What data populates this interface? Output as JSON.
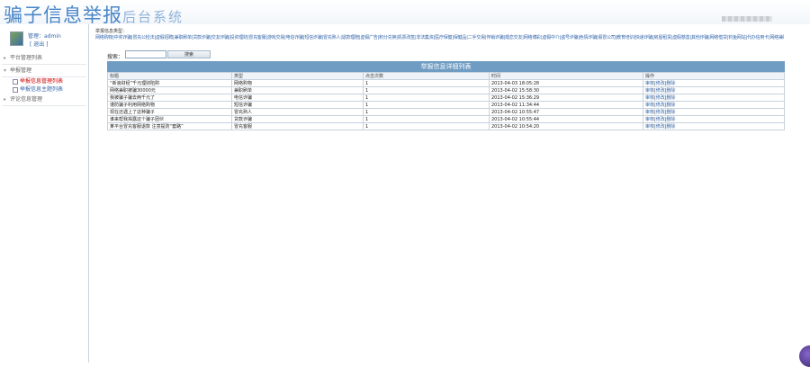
{
  "header": {
    "title": "骗子信息举报",
    "subtitle": "后台系统"
  },
  "user": {
    "name_line": "管理：admin",
    "logout": "[ 退出 ]"
  },
  "menu": {
    "items": [
      {
        "label": "平台管理列表",
        "subs": []
      },
      {
        "label": "举报管理",
        "subs": [
          {
            "label": "举报信息管理列表",
            "active": true
          },
          {
            "label": "举报信息主题列表",
            "active": false
          }
        ]
      },
      {
        "label": "评论信息管理",
        "subs": []
      }
    ]
  },
  "categories": {
    "title": "举报信息类型：",
    "list": "网络购物|中奖诈骗|冒充公检法|虚假招聘|兼职刷单|贷款诈骗|交友诈骗|投资理财|冒充客服|游戏交易|电信诈骗|短信诈骗|冒充熟人|退款理赔|虚假广告|积分兑换|机票改签|非法集资|医疗保健|保健品|二手交易|传销诈骗|婚恋交友|网络博彩|虚假中介|盗号诈骗|色情诈骗|假冒公司|教育培训|快递诈骗|房屋租赁|虚假慈善|其他诈骗|网络借贷|钓鱼网站|代办信用卡|网络兼职|虚假投资"
  },
  "search": {
    "label": "搜索：",
    "placeholder": "",
    "button": "搜索"
  },
  "table": {
    "caption": "举报信息详细列表",
    "columns": [
      "标题",
      "类型",
      "点击次数",
      "时间",
      "操作"
    ],
    "rows": [
      {
        "title": "“新浪财经”千元理财陷阱",
        "type": "网络购物",
        "clicks": "1",
        "time": "2013-04-03 18:05:28",
        "ops": [
          "审核",
          "修改",
          "删除"
        ]
      },
      {
        "title": "网络兼职被骗30000元",
        "type": "兼职刷单",
        "clicks": "1",
        "time": "2013-04-02 15:58:30",
        "ops": [
          "审核",
          "修改",
          "删除"
        ]
      },
      {
        "title": "我被骗子骗去两千元了",
        "type": "电信诈骗",
        "clicks": "1",
        "time": "2013-04-02 15:36:29",
        "ops": [
          "审核",
          "修改",
          "删除"
        ]
      },
      {
        "title": "谨防骗子利用网络购物",
        "type": "短信诈骗",
        "clicks": "1",
        "time": "2013-04-02 11:34:44",
        "ops": [
          "审核",
          "修改",
          "删除"
        ]
      },
      {
        "title": "现在还遇上了这种骗子",
        "type": "冒充熟人",
        "clicks": "1",
        "time": "2013-04-02 10:55:47",
        "ops": [
          "审核",
          "修改",
          "删除"
        ]
      },
      {
        "title": "谁来帮我揭露这个骗子团伙",
        "type": "贷款诈骗",
        "clicks": "1",
        "time": "2013-04-02 10:55:44",
        "ops": [
          "审核",
          "修改",
          "删除"
        ]
      },
      {
        "title": "某平台冒充客服退款 注意提防“套路”",
        "type": "冒充客服",
        "clicks": "1",
        "time": "2013-04-02 10:54:20",
        "ops": [
          "审核",
          "修改",
          "删除"
        ]
      }
    ]
  }
}
